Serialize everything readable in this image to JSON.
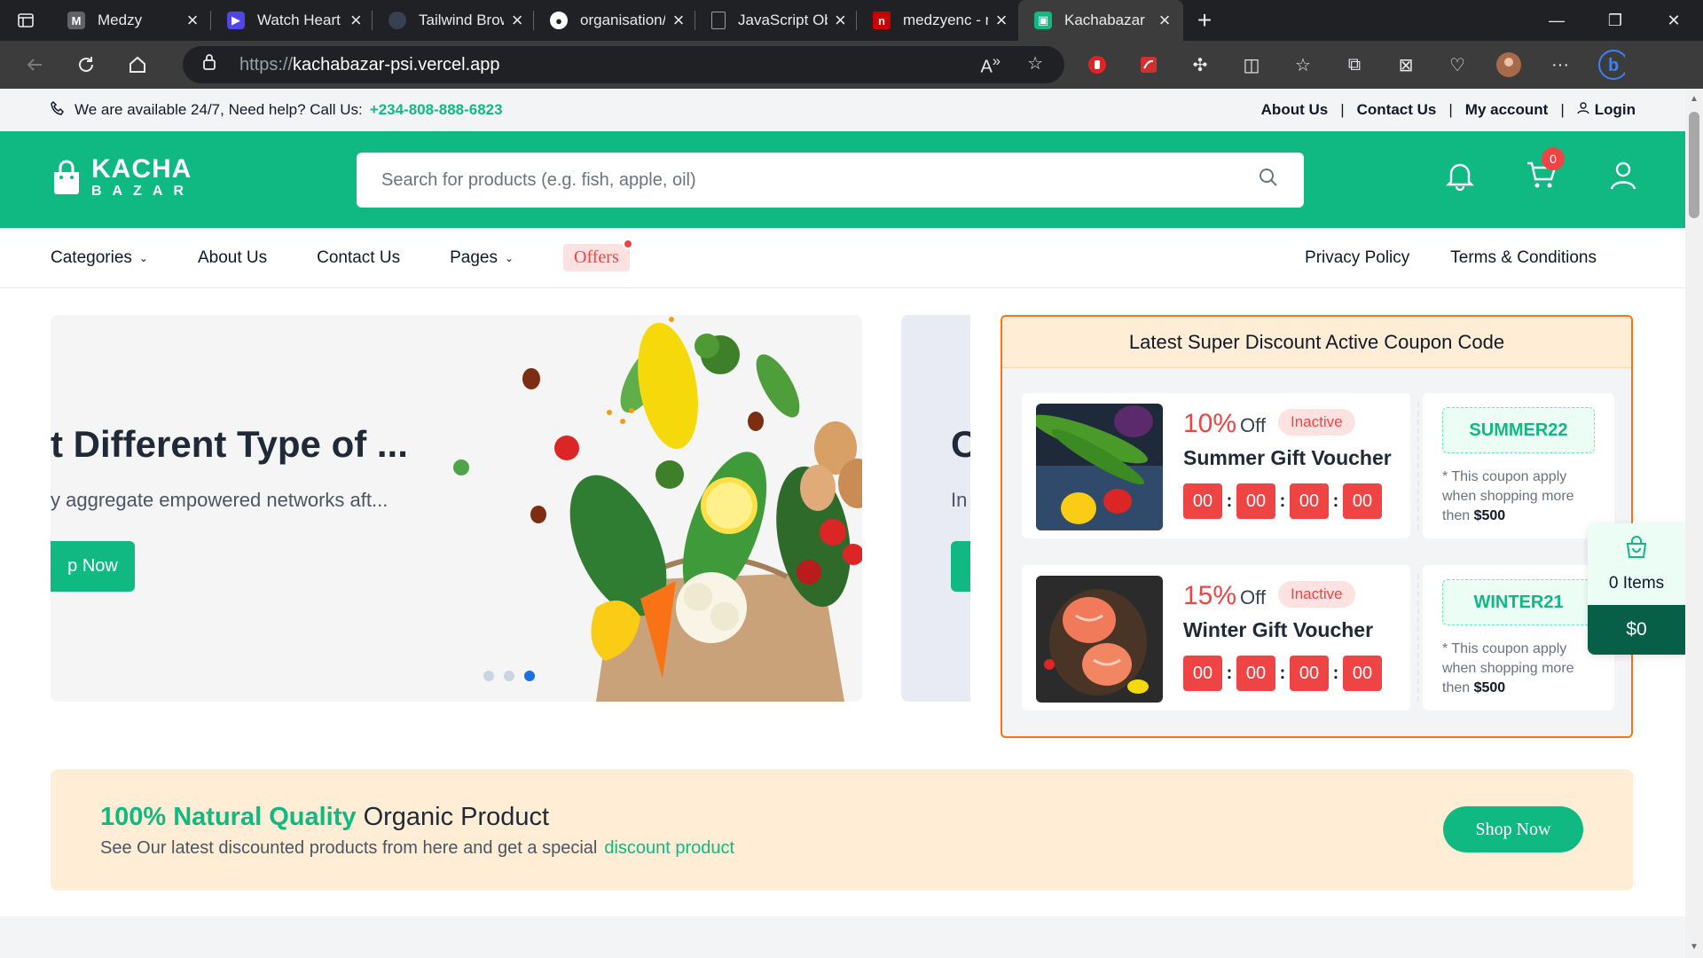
{
  "browser": {
    "tabs": [
      {
        "title": "Medzy",
        "favicon": "gmail-icon",
        "color": "#5f6368"
      },
      {
        "title": "Watch Heart of S",
        "favicon": "play-icon",
        "color": "#4f46e5"
      },
      {
        "title": "Tailwind Browser",
        "favicon": "tailwind-icon",
        "color": "#6b7280"
      },
      {
        "title": "organisation/src/",
        "favicon": "github-icon",
        "color": "#ffffff"
      },
      {
        "title": "JavaScript Obfusc",
        "favicon": "document-icon",
        "color": "#9aa0a6"
      },
      {
        "title": "medzyenc - npm",
        "favicon": "npm-icon",
        "color": "#cb0000"
      },
      {
        "title": "Kachabazar",
        "favicon": "bag-icon",
        "color": "#10b981",
        "active": true
      }
    ],
    "url_prefix": "https://",
    "url_host": "kachabazar-psi.vercel.app"
  },
  "topbar": {
    "help_text": "We are available 24/7, Need help? Call Us:",
    "phone": "+234-808-888-6823",
    "links": [
      "About Us",
      "Contact Us",
      "My account"
    ],
    "login": "Login"
  },
  "header": {
    "logo_top": "KACHA",
    "logo_bottom": "BAZAR",
    "search_placeholder": "Search for products (e.g. fish, apple, oil)",
    "cart_count": "0",
    "brand_color": "#10b981"
  },
  "menu": {
    "categories": "Categories",
    "about": "About Us",
    "contact": "Contact Us",
    "pages": "Pages",
    "offers": "Offers",
    "privacy": "Privacy Policy",
    "terms": "Terms & Conditions"
  },
  "hero": {
    "title": "t Different Type of ...",
    "subtitle": "y aggregate empowered networks aft...",
    "button": "p Now",
    "next_title": "C",
    "next_subtitle": "In",
    "active_dot": 3
  },
  "coupons": {
    "heading": "Latest Super Discount Active Coupon Code",
    "items": [
      {
        "percent": "10%",
        "off": "Off",
        "status": "Inactive",
        "name": "Summer Gift Voucher",
        "timer": [
          "00",
          "00",
          "00",
          "00"
        ],
        "code": "SUMMER22",
        "note": "* This coupon apply when shopping more then",
        "min": "$500"
      },
      {
        "percent": "15%",
        "off": "Off",
        "status": "Inactive",
        "name": "Winter Gift Voucher",
        "timer": [
          "00",
          "00",
          "00",
          "00"
        ],
        "code": "WINTER21",
        "note": "* This coupon apply when shopping more then",
        "min": "$500"
      }
    ]
  },
  "floatcart": {
    "items": "0 Items",
    "total": "$0"
  },
  "promo": {
    "highlight": "100% Natural Quality",
    "title_rest": "Organic Product",
    "subtitle": "See Our latest discounted products from here and get a special",
    "link": "discount product",
    "button": "Shop Now"
  }
}
